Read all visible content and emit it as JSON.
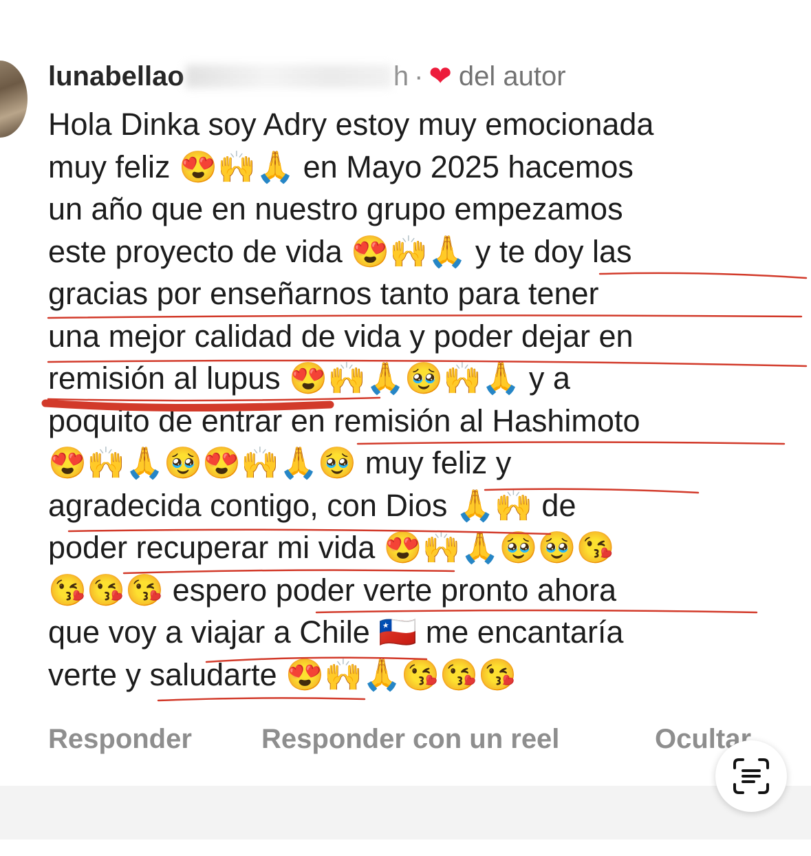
{
  "comment": {
    "username": "lunabellao",
    "time": "h",
    "separator": "·",
    "liked_by_author": "del autor",
    "text": "Hola Dinka soy Adry estoy muy emocionada\nmuy feliz 😍🙌🙏 en Mayo 2025 hacemos\nun año que en nuestro grupo empezamos\neste proyecto de vida 😍🙌🙏 y te doy las\ngracias por enseñarnos tanto para tener\nuna mejor calidad de vida y poder dejar en\nremisión al lupus 😍🙌🙏🥹🙌🙏 y a\npoquito de entrar en remisión al Hashimoto\n😍🙌🙏🥹😍🙌🙏🥹 muy feliz y\nagradecida contigo, con Dios 🙏🙌 de\npoder recuperar mi vida 😍🙌🙏🥹🥹😘\n😘😘😘 espero poder verte pronto ahora\nque voy a viajar a Chile 🇨🇱 me encantaría\nverte y saludarte 😍🙌🙏😘😘😘"
  },
  "actions": {
    "reply": "Responder",
    "reply_reel": "Responder con un reel",
    "hide": "Ocultar"
  },
  "icons": {
    "heart": "heart-icon",
    "scan_text": "scan-text-icon"
  },
  "colors": {
    "heart": "#ed1c3c",
    "annotation": "#d23a2a"
  }
}
